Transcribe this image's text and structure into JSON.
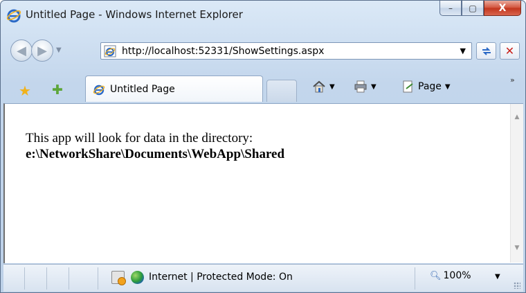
{
  "window": {
    "title": "Untitled Page - Windows Internet Explorer",
    "controls": {
      "minimize": "–",
      "maximize": "▢",
      "close": "X"
    }
  },
  "nav": {
    "back_icon": "◀",
    "forward_icon": "▶",
    "dropdown": "▼",
    "url": "http://localhost:52331/ShowSettings.aspx",
    "address_dropdown": "▼",
    "refresh_icon": "⁴↯",
    "stop_icon": "✕"
  },
  "tabs": {
    "favorites_icon": "★",
    "add_favorite_icon": "✚",
    "active_tab": "Untitled Page"
  },
  "commands": {
    "home_icon": "⌂",
    "print_icon": "⎙",
    "page_label": "Page",
    "dropdown": "▼",
    "more": "»"
  },
  "content": {
    "line1": "This app will look for data in the directory:",
    "path": "e:\\NetworkShare\\Documents\\WebApp\\Shared"
  },
  "status": {
    "zone": "Internet | Protected Mode: On",
    "zoom": "100%",
    "zoom_dropdown": "▼"
  },
  "colors": {
    "chrome": "#c3d6ec",
    "close_button": "#c1341c",
    "ie_blue": "#2b69c6"
  }
}
